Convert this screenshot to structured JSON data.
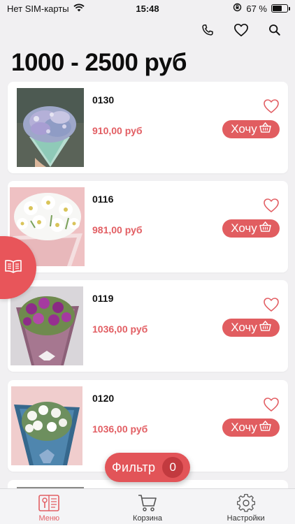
{
  "status_bar": {
    "carrier": "Нет SIM-карты",
    "time": "15:48",
    "battery": "67 %",
    "battery_level": 0.67
  },
  "header": {
    "title": "1000 - 2500 руб"
  },
  "products": [
    {
      "sku": "0130",
      "price": "910,00 руб",
      "want_label": "Хочу"
    },
    {
      "sku": "0116",
      "price": "981,00 руб",
      "want_label": "Хочу"
    },
    {
      "sku": "0119",
      "price": "1036,00 руб",
      "want_label": "Хочу"
    },
    {
      "sku": "0120",
      "price": "1036,00 руб",
      "want_label": "Хочу"
    }
  ],
  "filter": {
    "label": "Фильтр",
    "count": "0"
  },
  "tabs": [
    {
      "label": "Меню",
      "icon": "menu-book-icon",
      "active": true
    },
    {
      "label": "Корзина",
      "icon": "cart-icon",
      "active": false
    },
    {
      "label": "Настройки",
      "icon": "gear-icon",
      "active": false
    }
  ],
  "colors": {
    "accent": "#e25e63",
    "button": "#e15d60",
    "filter_badge": "#c23a3f",
    "background": "#f1f0f2"
  }
}
